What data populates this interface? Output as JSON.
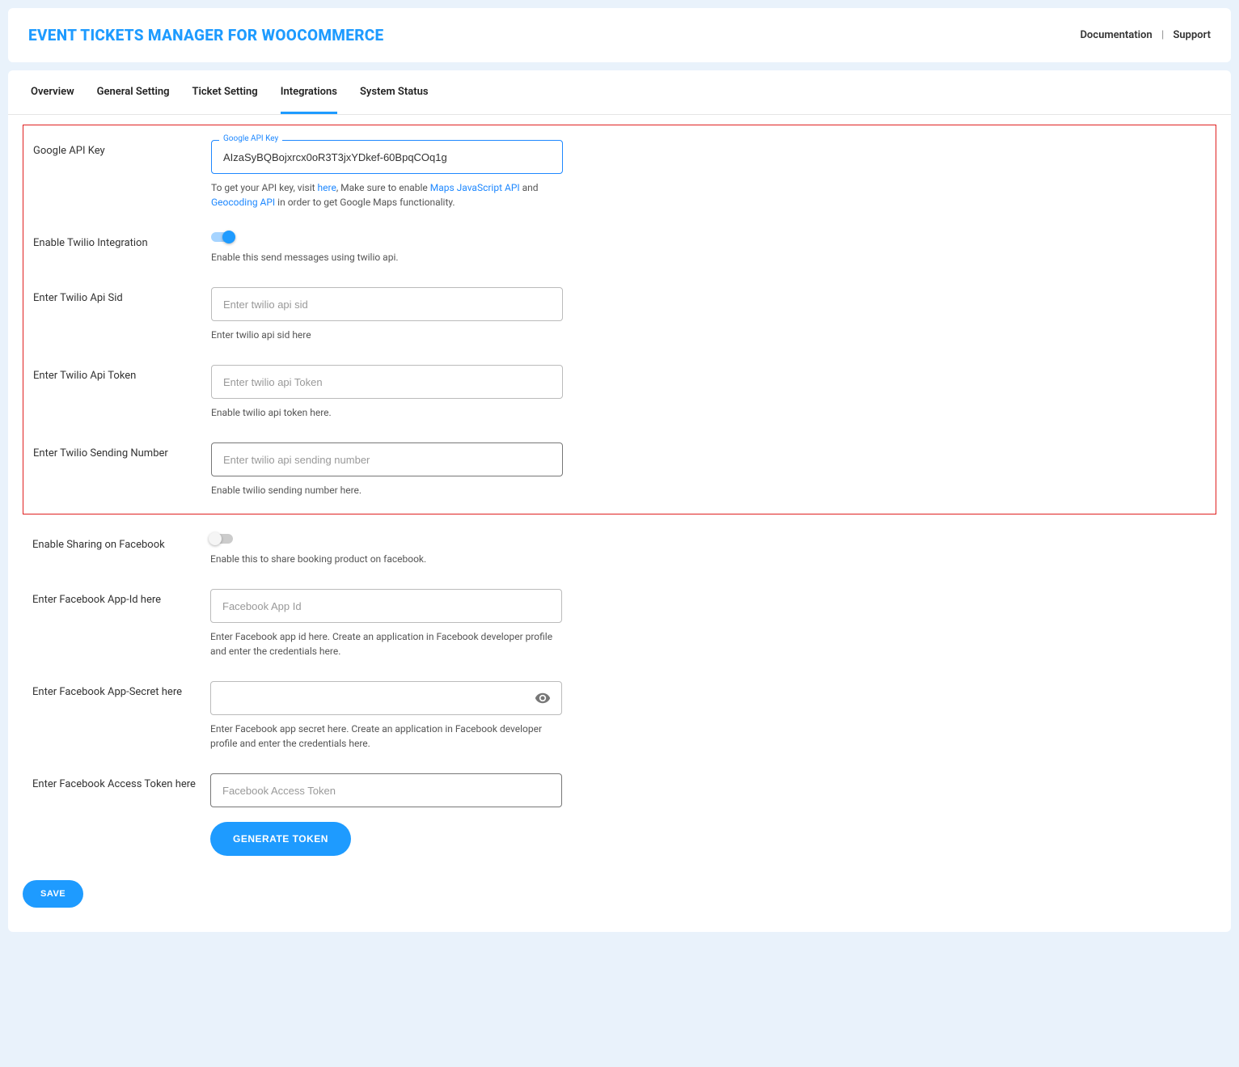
{
  "header": {
    "title": "EVENT TICKETS MANAGER FOR WOOCOMMERCE",
    "doc_link": "Documentation",
    "support_link": "Support"
  },
  "tabs": {
    "overview": "Overview",
    "general": "General Setting",
    "ticket": "Ticket Setting",
    "integrations": "Integrations",
    "system": "System Status"
  },
  "google_api": {
    "label": "Google API Key",
    "float_label": "Google API Key",
    "value": "AIzaSyBQBojxrcx0oR3T3jxYDkef-60BpqCOq1g",
    "help_prefix": "To get your API key, visit ",
    "help_here": "here",
    "help_mid": ", Make sure to enable ",
    "help_maps_js": "Maps JavaScript API",
    "help_and": " and ",
    "help_geocoding": "Geocoding API",
    "help_suffix": " in order to get Google Maps functionality."
  },
  "twilio_enable": {
    "label": "Enable Twilio Integration",
    "help": "Enable this send messages using twilio api."
  },
  "twilio_sid": {
    "label": "Enter Twilio Api Sid",
    "placeholder": "Enter twilio api sid",
    "help": "Enter twilio api sid here"
  },
  "twilio_token": {
    "label": "Enter Twilio Api Token",
    "placeholder": "Enter twilio api Token",
    "help": "Enable twilio api token here."
  },
  "twilio_number": {
    "label": "Enter Twilio Sending Number",
    "placeholder": "Enter twilio api sending number",
    "help": "Enable twilio sending number here."
  },
  "fb_enable": {
    "label": "Enable Sharing on Facebook",
    "help": "Enable this to share booking product on facebook."
  },
  "fb_app_id": {
    "label": "Enter Facebook App-Id here",
    "placeholder": "Facebook App Id",
    "help": "Enter Facebook app id here. Create an application in Facebook developer profile and enter the credentials here."
  },
  "fb_app_secret": {
    "label": "Enter Facebook App-Secret here",
    "help": "Enter Facebook app secret here. Create an application in Facebook developer profile and enter the credentials here."
  },
  "fb_access_token": {
    "label": "Enter Facebook Access Token here",
    "placeholder": "Facebook Access Token"
  },
  "buttons": {
    "generate_token": "GENERATE TOKEN",
    "save": "SAVE"
  }
}
